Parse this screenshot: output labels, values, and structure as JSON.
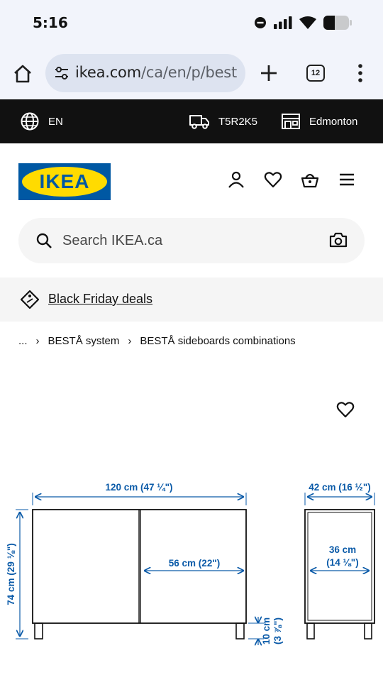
{
  "status_bar": {
    "time": "5:16"
  },
  "browser": {
    "url_main": "ikea.com",
    "url_path": "/ca/en/p/best",
    "tab_count": "12"
  },
  "top_strip": {
    "language": "EN",
    "postal_code": "T5R2K5",
    "store": "Edmonton"
  },
  "header": {
    "logo_text": "IKEA"
  },
  "search": {
    "placeholder": "Search IKEA.ca"
  },
  "promo": {
    "deals_label": "Black Friday deals"
  },
  "breadcrumb": {
    "ellipsis": "...",
    "items": [
      "BESTÅ system",
      "BESTÅ sideboards combinations"
    ]
  },
  "dimensions": {
    "width": "120 cm (47 ¼\")",
    "door_width": "56 cm (22\")",
    "height": "74 cm (29 ⅛\")",
    "depth": "42 cm (16 ½\")",
    "inner_depth_cm": "36 cm",
    "inner_depth_in": "(14 ⅛\")",
    "leg_height_cm": "10 cm",
    "leg_height_in": "(3 ⅞\")"
  },
  "colors": {
    "ikea_blue": "#0058a3",
    "ikea_yellow": "#ffdb00",
    "dimension_blue": "#0a5aa8",
    "strip_black": "#111111"
  },
  "icons": [
    "home-icon",
    "tune-icon",
    "plus-icon",
    "tabs-icon",
    "more-vert-icon",
    "globe-icon",
    "truck-icon",
    "store-icon",
    "user-icon",
    "heart-icon",
    "basket-icon",
    "hamburger-icon",
    "search-icon",
    "camera-icon",
    "tag-icon"
  ]
}
